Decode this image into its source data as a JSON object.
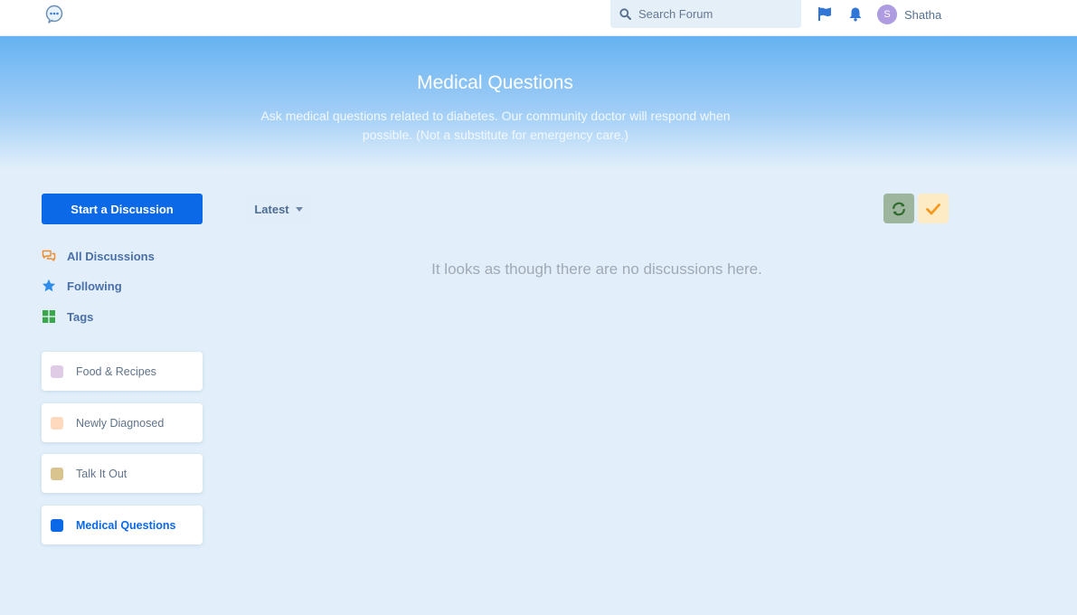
{
  "header": {
    "search_placeholder": "Search Forum",
    "avatar_initial": "S",
    "username": "Shatha",
    "icons": [
      "forum-logo-icon",
      "search-icon",
      "flag-icon",
      "bell-icon"
    ]
  },
  "hero": {
    "title": "Medical Questions",
    "description": "Ask medical questions related to diabetes. Our community doctor will respond when possible. (Not a substitute for emergency care.)"
  },
  "sidebar": {
    "start_label": "Start a Discussion",
    "nav": [
      {
        "label": "All Discussions",
        "icon": "chat-bubbles-icon"
      },
      {
        "label": "Following",
        "icon": "star-icon"
      },
      {
        "label": "Tags",
        "icon": "grid-icon"
      }
    ],
    "tags": [
      {
        "label": "Food & Recipes",
        "color": "#e0cbe6"
      },
      {
        "label": "Newly Diagnosed",
        "color": "#ffd9bd"
      },
      {
        "label": "Talk It Out",
        "color": "#d9c48f"
      },
      {
        "label": "Medical Questions",
        "color": "#0b69e8",
        "active": true
      }
    ]
  },
  "toolbar": {
    "sort_label": "Latest",
    "refresh_icon": "refresh-icon",
    "mark_read_icon": "checkmark-icon"
  },
  "main": {
    "empty_message": "It looks as though there are no discussions here."
  },
  "colors": {
    "primary": "#0b69e8",
    "hero_top": "#66b2f2",
    "background": "#e2effa"
  }
}
